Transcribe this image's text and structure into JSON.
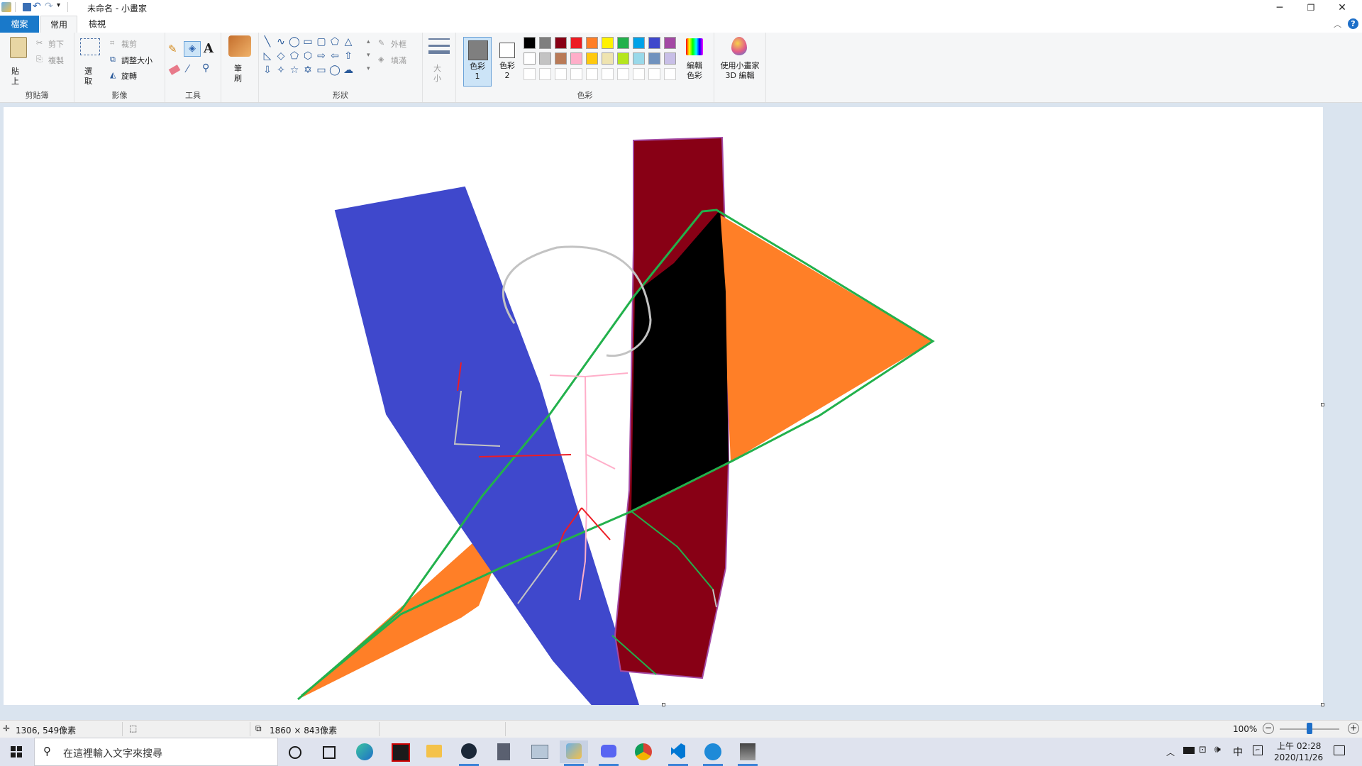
{
  "window": {
    "title": "未命名 - 小畫家"
  },
  "tabs": {
    "file": "檔案",
    "home": "常用",
    "view": "檢視"
  },
  "clipboard": {
    "paste": "貼上",
    "cut": "剪下",
    "copy": "複製",
    "label": "剪貼簿"
  },
  "image": {
    "select": "選取",
    "crop": "裁剪",
    "resize": "調整大小",
    "rotate": "旋轉",
    "label": "影像"
  },
  "tools": {
    "label": "工具"
  },
  "brushes": {
    "label": "筆刷"
  },
  "shapes": {
    "outline": "外框",
    "fill": "填滿",
    "label": "形狀"
  },
  "size": {
    "label": "大小"
  },
  "colors": {
    "color1": "色彩 1",
    "color2": "色彩 2",
    "edit": "編輯色彩",
    "label": "色彩",
    "color1_value": "#7f7f7f",
    "color2_value": "#ffffff",
    "palette_row1": [
      "#000000",
      "#7f7f7f",
      "#880015",
      "#ed1c24",
      "#ff7f27",
      "#fff200",
      "#22b14c",
      "#00a2e8",
      "#3f48cc",
      "#a349a4"
    ],
    "palette_row2": [
      "#ffffff",
      "#c3c3c3",
      "#b97a57",
      "#ffaec9",
      "#ffc90e",
      "#efe4b0",
      "#b5e61d",
      "#99d9ea",
      "#7092be",
      "#c8bfe7"
    ]
  },
  "paint3d": {
    "label": "使用小畫家 3D 編輯"
  },
  "status": {
    "cursor": "1306, 549像素",
    "size": "1860 × 843像素",
    "zoom": "100%"
  },
  "taskbar": {
    "search_placeholder": "在這裡輸入文字來搜尋",
    "time": "上午 02:28",
    "date": "2020/11/26",
    "ime": "中"
  }
}
